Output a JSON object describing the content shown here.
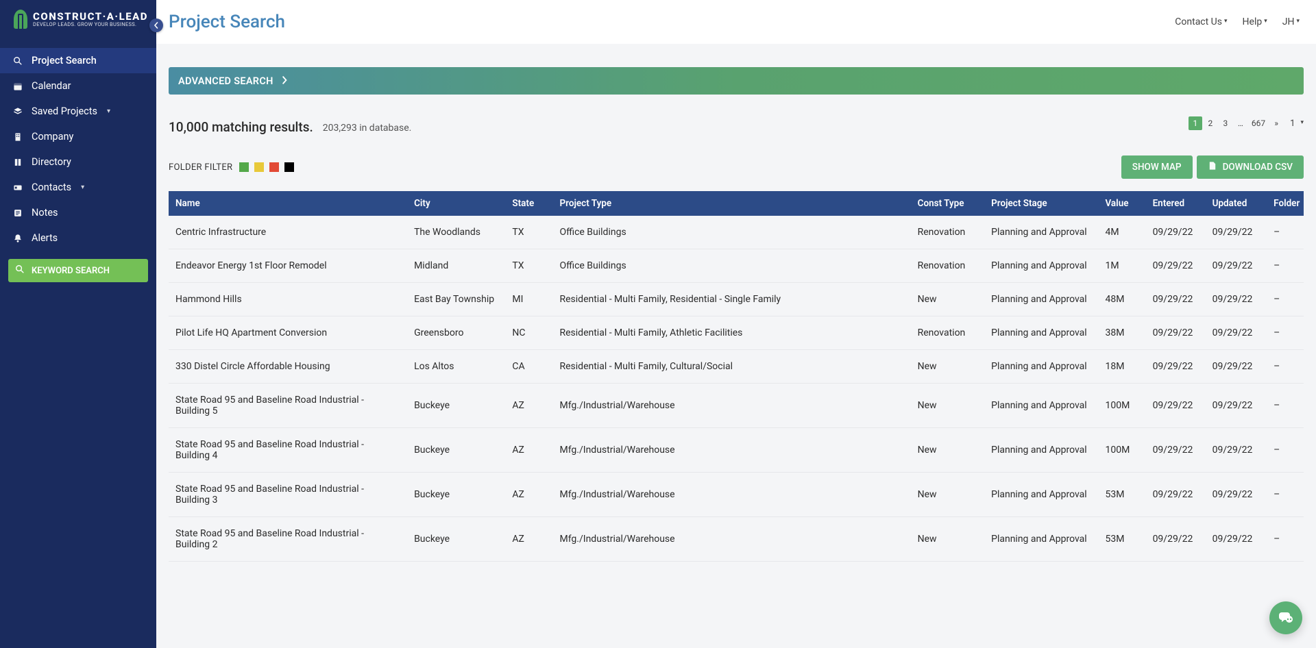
{
  "brand": {
    "name": "CONSTRUCT·A·LEAD",
    "tagline": "DEVELOP LEADS. GROW YOUR BUSINESS."
  },
  "sidebar": {
    "items": [
      {
        "icon": "search",
        "label": "Project Search",
        "active": true,
        "caret": false
      },
      {
        "icon": "calendar",
        "label": "Calendar",
        "active": false,
        "caret": false
      },
      {
        "icon": "stack",
        "label": "Saved Projects",
        "active": false,
        "caret": true
      },
      {
        "icon": "building",
        "label": "Company",
        "active": false,
        "caret": false
      },
      {
        "icon": "book",
        "label": "Directory",
        "active": false,
        "caret": false
      },
      {
        "icon": "card",
        "label": "Contacts",
        "active": false,
        "caret": true
      },
      {
        "icon": "note",
        "label": "Notes",
        "active": false,
        "caret": false
      },
      {
        "icon": "bell",
        "label": "Alerts",
        "active": false,
        "caret": false
      }
    ],
    "keyword_button": "KEYWORD SEARCH"
  },
  "header": {
    "title": "Project Search",
    "links": [
      {
        "label": "Contact Us",
        "caret": true
      },
      {
        "label": "Help",
        "caret": true
      },
      {
        "label": "JH",
        "caret": true
      }
    ]
  },
  "adv_search_label": "ADVANCED SEARCH",
  "results": {
    "matching": "10,000 matching results.",
    "database": "203,293 in database."
  },
  "pagination": {
    "pages": [
      "1",
      "2",
      "3",
      "…",
      "667",
      "»"
    ],
    "active": "1",
    "dropdown_value": "1"
  },
  "folder_filter": {
    "label": "FOLDER FILTER",
    "swatches": [
      "#54a84a",
      "#e8c93a",
      "#e24a36",
      "#000000"
    ]
  },
  "buttons": {
    "show_map": "SHOW MAP",
    "download_csv": "DOWNLOAD CSV"
  },
  "table": {
    "columns": [
      "Name",
      "City",
      "State",
      "Project Type",
      "Const Type",
      "Project Stage",
      "Value",
      "Entered",
      "Updated",
      "Folder"
    ],
    "col_widths": [
      "272px",
      "112px",
      "54px",
      "408px",
      "84px",
      "130px",
      "54px",
      "68px",
      "70px",
      "42px"
    ],
    "rows": [
      {
        "name": "Centric Infrastructure",
        "city": "The Woodlands",
        "state": "TX",
        "ptype": "Office Buildings",
        "ctype": "Renovation",
        "stage": "Planning and Approval",
        "value": "4M",
        "entered": "09/29/22",
        "updated": "09/29/22",
        "folder": "–"
      },
      {
        "name": "Endeavor Energy 1st Floor Remodel",
        "city": "Midland",
        "state": "TX",
        "ptype": "Office Buildings",
        "ctype": "Renovation",
        "stage": "Planning and Approval",
        "value": "1M",
        "entered": "09/29/22",
        "updated": "09/29/22",
        "folder": "–"
      },
      {
        "name": "Hammond Hills",
        "city": "East Bay Township",
        "state": "MI",
        "ptype": "Residential - Multi Family, Residential - Single Family",
        "ctype": "New",
        "stage": "Planning and Approval",
        "value": "48M",
        "entered": "09/29/22",
        "updated": "09/29/22",
        "folder": "–"
      },
      {
        "name": "Pilot Life HQ Apartment Conversion",
        "city": "Greensboro",
        "state": "NC",
        "ptype": "Residential - Multi Family, Athletic Facilities",
        "ctype": "Renovation",
        "stage": "Planning and Approval",
        "value": "38M",
        "entered": "09/29/22",
        "updated": "09/29/22",
        "folder": "–"
      },
      {
        "name": "330 Distel Circle Affordable Housing",
        "city": "Los Altos",
        "state": "CA",
        "ptype": "Residential - Multi Family, Cultural/Social",
        "ctype": "New",
        "stage": "Planning and Approval",
        "value": "18M",
        "entered": "09/29/22",
        "updated": "09/29/22",
        "folder": "–"
      },
      {
        "name": "State Road 95 and Baseline Road Industrial - Building 5",
        "city": "Buckeye",
        "state": "AZ",
        "ptype": "Mfg./Industrial/Warehouse",
        "ctype": "New",
        "stage": "Planning and Approval",
        "value": "100M",
        "entered": "09/29/22",
        "updated": "09/29/22",
        "folder": "–"
      },
      {
        "name": "State Road 95 and Baseline Road Industrial - Building 4",
        "city": "Buckeye",
        "state": "AZ",
        "ptype": "Mfg./Industrial/Warehouse",
        "ctype": "New",
        "stage": "Planning and Approval",
        "value": "100M",
        "entered": "09/29/22",
        "updated": "09/29/22",
        "folder": "–"
      },
      {
        "name": "State Road 95 and Baseline Road Industrial - Building 3",
        "city": "Buckeye",
        "state": "AZ",
        "ptype": "Mfg./Industrial/Warehouse",
        "ctype": "New",
        "stage": "Planning and Approval",
        "value": "53M",
        "entered": "09/29/22",
        "updated": "09/29/22",
        "folder": "–"
      },
      {
        "name": "State Road 95 and Baseline Road Industrial - Building 2",
        "city": "Buckeye",
        "state": "AZ",
        "ptype": "Mfg./Industrial/Warehouse",
        "ctype": "New",
        "stage": "Planning and Approval",
        "value": "53M",
        "entered": "09/29/22",
        "updated": "09/29/22",
        "folder": "–"
      }
    ]
  }
}
